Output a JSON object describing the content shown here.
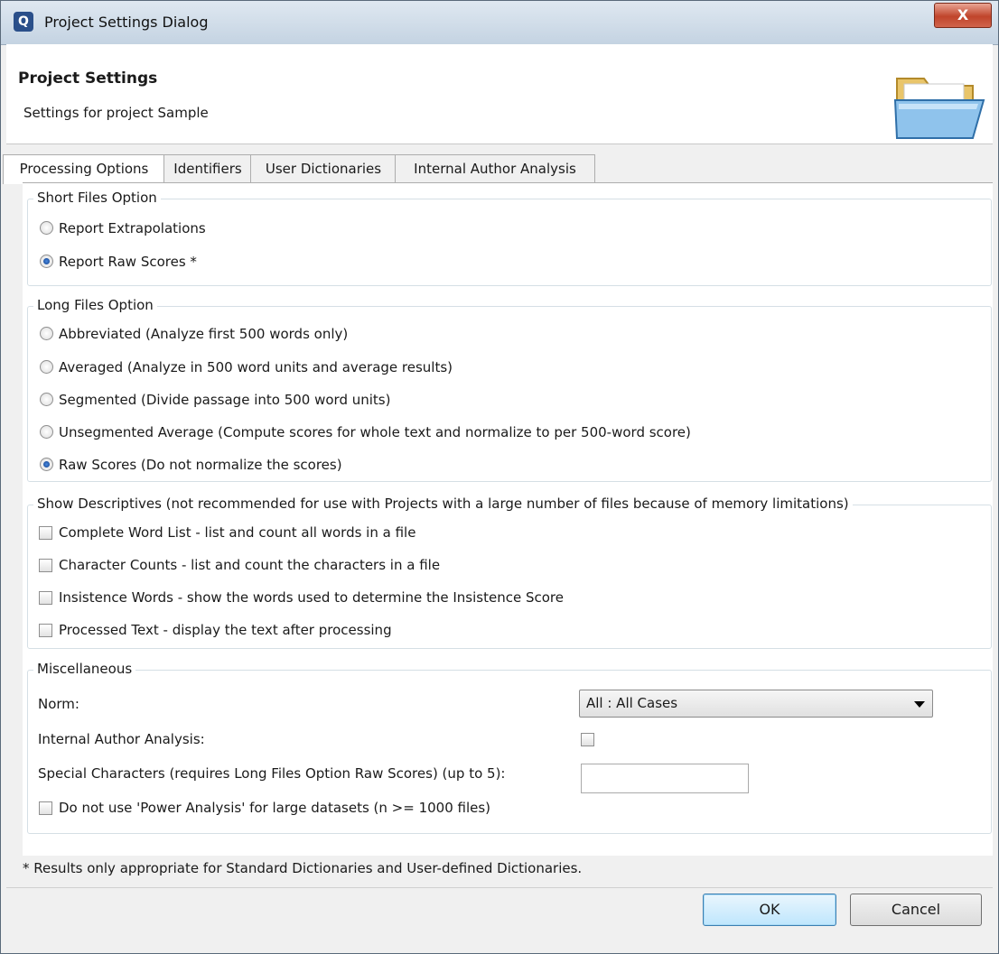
{
  "window": {
    "title": "Project Settings Dialog",
    "close_label": "X",
    "app_icon_letter": "Q"
  },
  "header": {
    "title": "Project Settings",
    "subtitle": "Settings for project Sample",
    "icon": "folder-open-icon"
  },
  "tabs": [
    {
      "label": "Processing Options",
      "active": true
    },
    {
      "label": "Identifiers",
      "active": false
    },
    {
      "label": "User Dictionaries",
      "active": false
    },
    {
      "label": "Internal Author Analysis",
      "active": false
    }
  ],
  "short_files": {
    "legend": "Short Files Option",
    "options": [
      {
        "label": "Report Extrapolations",
        "selected": false
      },
      {
        "label": "Report Raw Scores *",
        "selected": true
      }
    ]
  },
  "long_files": {
    "legend": "Long Files Option",
    "options": [
      {
        "label": "Abbreviated (Analyze first 500 words only)",
        "selected": false
      },
      {
        "label": "Averaged (Analyze in 500 word units and average results)",
        "selected": false
      },
      {
        "label": "Segmented (Divide passage into 500 word units)",
        "selected": false
      },
      {
        "label": "Unsegmented Average (Compute scores for whole text and normalize to per 500-word score)",
        "selected": false
      },
      {
        "label": "Raw Scores (Do not normalize the scores)",
        "selected": true
      }
    ]
  },
  "descriptives": {
    "legend": "Show Descriptives (not recommended for use with Projects with a large number of files because of memory limitations)",
    "options": [
      {
        "label": "Complete Word List - list and count all words in a file",
        "checked": false
      },
      {
        "label": "Character Counts - list and count the characters in a file",
        "checked": false
      },
      {
        "label": "Insistence Words - show the words used to determine the Insistence Score",
        "checked": false
      },
      {
        "label": "Processed Text - display the text after processing",
        "checked": false
      }
    ]
  },
  "misc": {
    "legend": "Miscellaneous",
    "norm_label": "Norm:",
    "norm_value": "All : All Cases",
    "iaa_label": "Internal Author Analysis:",
    "iaa_checked": false,
    "special_label": "Special Characters (requires Long Files Option Raw Scores) (up to 5):",
    "special_value": "",
    "power_label": "Do not use 'Power Analysis' for large datasets (n >= 1000 files)",
    "power_checked": false
  },
  "footnote": "* Results only appropriate for Standard Dictionaries and User-defined Dictionaries.",
  "buttons": {
    "ok": "OK",
    "cancel": "Cancel"
  }
}
